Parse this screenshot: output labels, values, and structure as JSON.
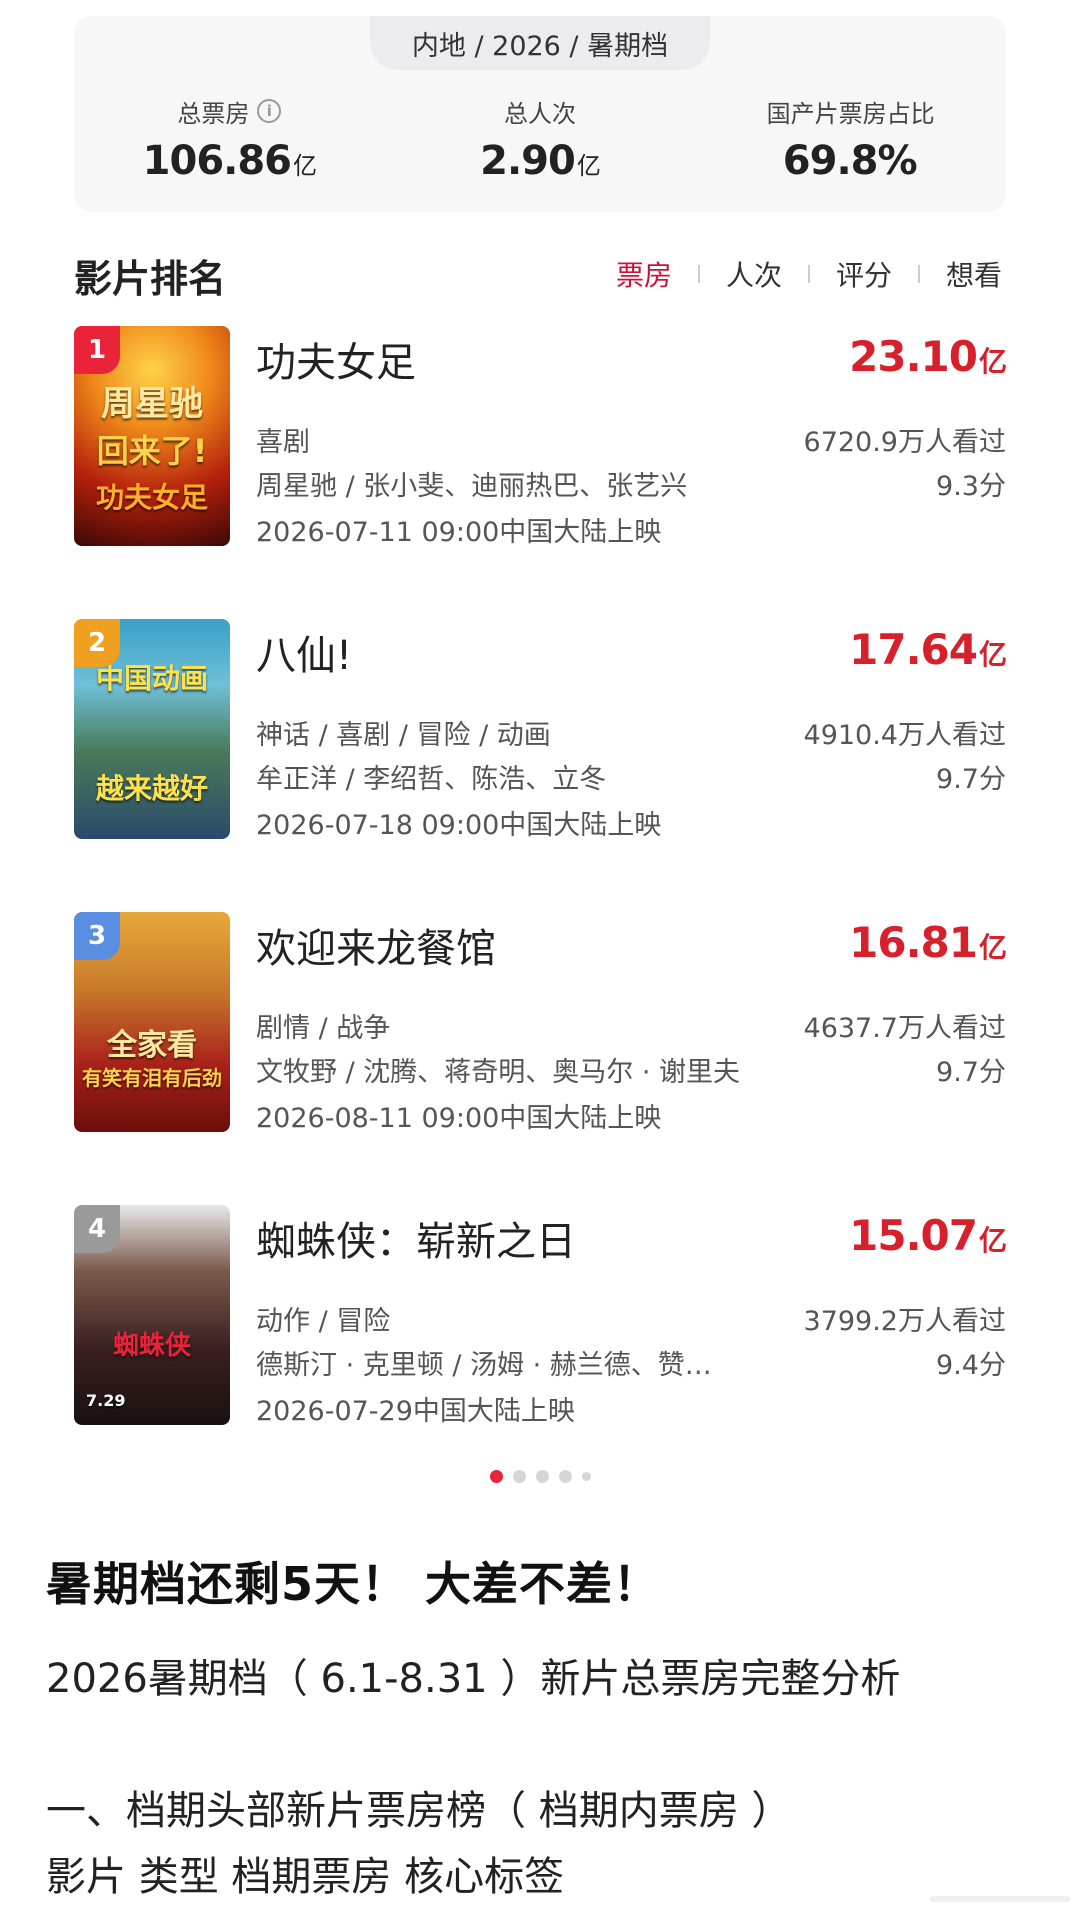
{
  "summary": {
    "tab": "内地 / 2026 / 暑期档",
    "stats": [
      {
        "label": "总票房",
        "value": "106.86",
        "unit": "亿"
      },
      {
        "label": "总人次",
        "value": "2.90",
        "unit": "亿"
      },
      {
        "label": "国产片票房占比",
        "value": "69.8%",
        "unit": ""
      }
    ]
  },
  "ranking": {
    "title": "影片排名",
    "tabs": [
      "票房",
      "人次",
      "评分",
      "想看"
    ]
  },
  "movies": [
    {
      "rank": "1",
      "title": "功夫女足",
      "box": "23.10",
      "unit": "亿",
      "genre": "喜剧",
      "cast": "周星驰 / 张小斐、迪丽热巴、张艺兴",
      "release": "2026-07-11 09:00中国大陆上映",
      "viewers": "6720.9万人看过",
      "score": "9.3分",
      "poster_text": [
        "周星驰",
        "回来了!",
        "功夫女足"
      ],
      "badge_color": "#e8233a"
    },
    {
      "rank": "2",
      "title": "八仙!",
      "box": "17.64",
      "unit": "亿",
      "genre": "神话 / 喜剧 / 冒险 / 动画",
      "cast": "牟正洋 / 李绍哲、陈浩、立冬",
      "release": "2026-07-18 09:00中国大陆上映",
      "viewers": "4910.4万人看过",
      "score": "9.7分",
      "poster_text": [
        "中国动画",
        "",
        "越来越好"
      ],
      "badge_color": "#f0a020"
    },
    {
      "rank": "3",
      "title": "欢迎来龙餐馆",
      "box": "16.81",
      "unit": "亿",
      "genre": "剧情 / 战争",
      "cast": "文牧野 / 沈腾、蒋奇明、奥马尔 · 谢里夫",
      "release": "2026-08-11 09:00中国大陆上映",
      "viewers": "4637.7万人看过",
      "score": "9.7分",
      "poster_text": [
        "",
        "全家看",
        "有笑有泪有后劲"
      ],
      "badge_color": "#5a8ee0"
    },
    {
      "rank": "4",
      "title": "蜘蛛侠：崭新之日",
      "box": "15.07",
      "unit": "亿",
      "genre": "动作 / 冒险",
      "cast": "德斯汀 · 克里顿 / 汤姆 · 赫兰德、赞…",
      "release": "2026-07-29中国大陆上映",
      "viewers": "3799.2万人看过",
      "score": "9.4分",
      "poster_text": [
        "",
        "蜘蛛侠",
        "7.29"
      ],
      "badge_color": "#9a9a9a"
    }
  ],
  "article": {
    "headline": "暑期档还剩5天！ 大差不差！",
    "line1": "2026暑期档（ 6.1-8.31 ）新片总票房完整分析",
    "line2": "一、档期头部新片票房榜（ 档期内票房 ）",
    "line3": "影片 类型 档期票房 核心标签"
  },
  "colors": {
    "accent": "#d6202b",
    "tab_active": "#c8143c",
    "dot_active": "#e8233a"
  }
}
